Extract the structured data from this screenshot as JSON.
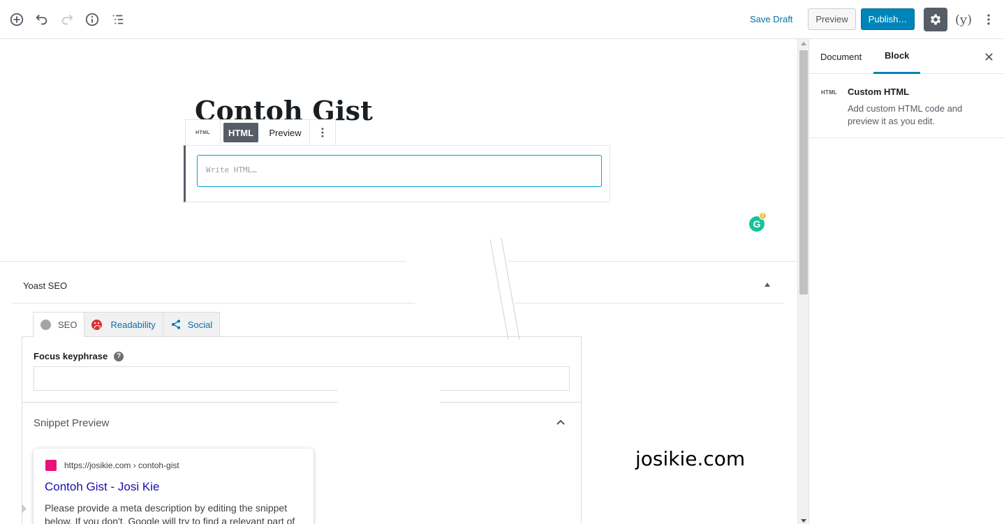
{
  "toolbar": {
    "save_draft": "Save Draft",
    "preview": "Preview",
    "publish": "Publish…",
    "yoast_icon_label": "(y)"
  },
  "post": {
    "title": "Contoh Gist"
  },
  "block_toolbar": {
    "type_icon": "HTML",
    "html_tab": "HTML",
    "preview_tab": "Preview"
  },
  "html_block": {
    "placeholder": "Write HTML…"
  },
  "yoast": {
    "title": "Yoast SEO",
    "tabs": [
      {
        "label": "SEO",
        "status": "gray"
      },
      {
        "label": "Readability",
        "status": "red"
      },
      {
        "label": "Social",
        "status": "share"
      }
    ],
    "focus_keyphrase_label": "Focus keyphrase",
    "focus_keyphrase_value": "",
    "snippet_preview_title": "Snippet Preview",
    "serp": {
      "url": "https://josikie.com › contoh-gist",
      "title": "Contoh Gist - Josi Kie",
      "description": "Please provide a meta description by editing the snippet below. If you don't, Google will try to find a relevant part of"
    }
  },
  "watermark": "josikie.com",
  "sidebar": {
    "tabs": [
      "Document",
      "Block"
    ],
    "active_tab": "Block",
    "block_icon": "HTML",
    "block_name": "Custom HTML",
    "block_description": "Add custom HTML code and preview it as you edit."
  },
  "colors": {
    "accent": "#0085ba",
    "link": "#0073aa",
    "serp_title": "#1a0dab",
    "readability_bad": "#dc3232",
    "grammarly": "#15c39a"
  }
}
